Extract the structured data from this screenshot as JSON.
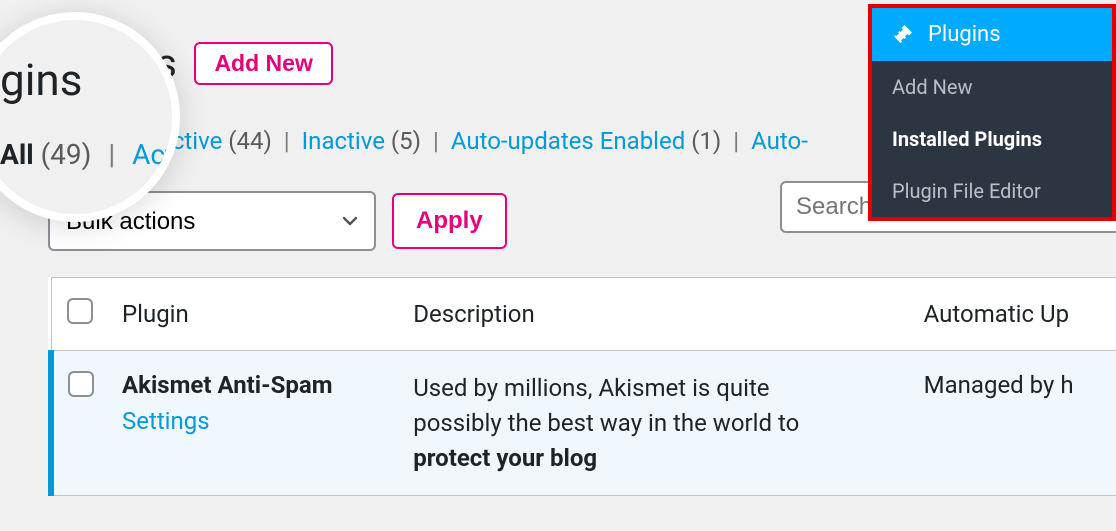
{
  "page": {
    "title": "Plugins",
    "add_new": "Add New"
  },
  "filters": {
    "all_label": "All",
    "all_count": "(49)",
    "active_label": "Active",
    "active_count": "(44)",
    "inactive_label": "Inactive",
    "inactive_count": "(5)",
    "auto_enabled_label": "Auto-updates Enabled",
    "auto_enabled_count": "(1)",
    "auto_partial_label": "Auto-"
  },
  "search": {
    "placeholder": "Search"
  },
  "bulk": {
    "select_label": "Bulk actions",
    "apply": "Apply"
  },
  "table": {
    "headers": {
      "plugin": "Plugin",
      "description": "Description",
      "auto": "Automatic Up"
    },
    "rows": [
      {
        "name": "Akismet Anti-Spam",
        "settings": "Settings",
        "desc_pre": "Used by millions, Akismet is quite possibly the best way in the world to ",
        "desc_bold": "protect your blog",
        "auto": "Managed by h"
      }
    ]
  },
  "sidebar": {
    "title": "Plugins",
    "items": [
      {
        "label": "Add New",
        "active": false
      },
      {
        "label": "Installed Plugins",
        "active": true
      },
      {
        "label": "Plugin File Editor",
        "active": false
      }
    ]
  },
  "lens": {
    "title_fragment": "gins",
    "all_label": "All",
    "all_count": "(49)",
    "active_label": "Active"
  }
}
